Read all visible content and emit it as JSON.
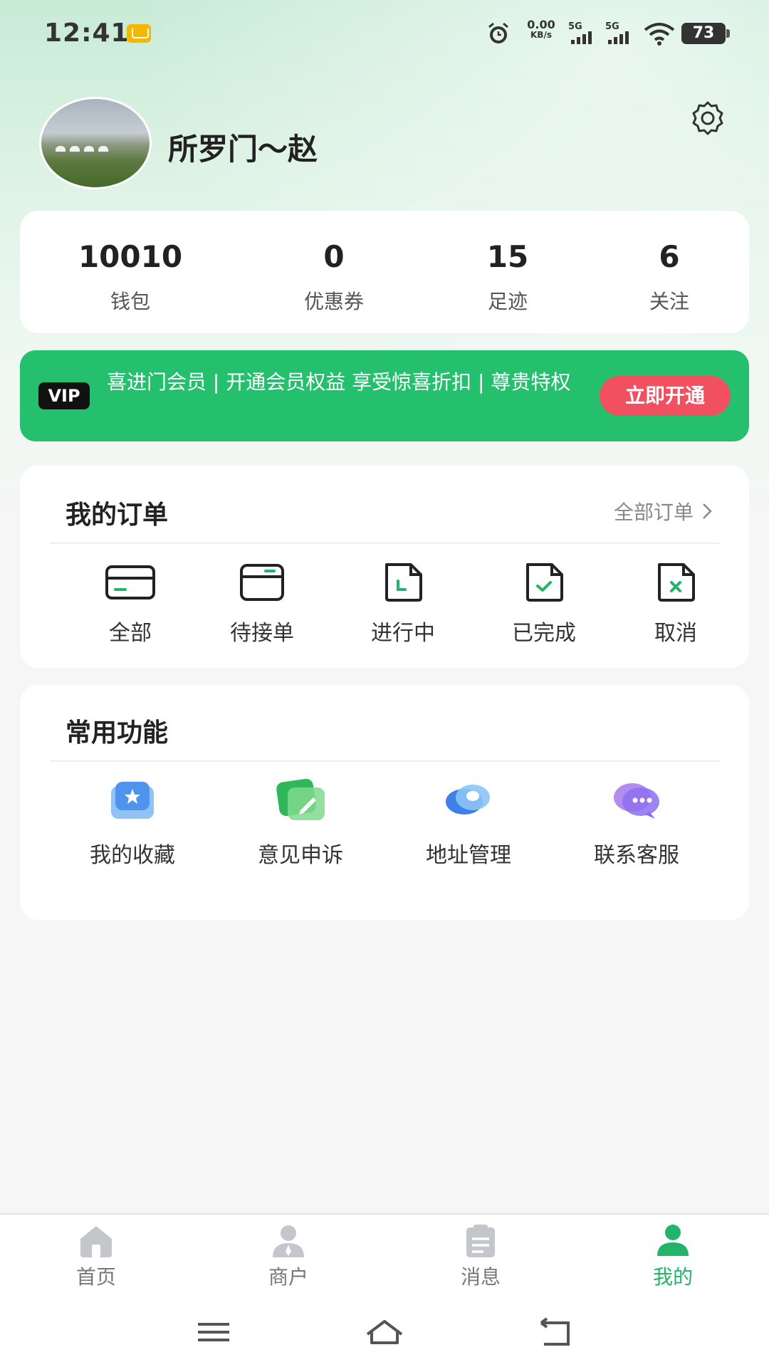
{
  "status_bar": {
    "time": "12:41",
    "net_speed_value": "0.00",
    "net_speed_unit": "KB/s",
    "signal_1": "5G",
    "signal_2": "5G",
    "battery": "73"
  },
  "profile": {
    "username": "所罗门～赵"
  },
  "stats": [
    {
      "value": "10010",
      "label": "钱包"
    },
    {
      "value": "0",
      "label": "优惠券"
    },
    {
      "value": "15",
      "label": "足迹"
    },
    {
      "value": "6",
      "label": "关注"
    }
  ],
  "vip": {
    "badge": "VIP",
    "text": "喜进门会员 | 开通会员权益 享受惊喜折扣 | 尊贵特权",
    "button": "立即开通"
  },
  "orders": {
    "title": "我的订单",
    "all_link": "全部订单",
    "items": [
      {
        "label": "全部",
        "icon": "card-icon"
      },
      {
        "label": "待接单",
        "icon": "inbox-icon"
      },
      {
        "label": "进行中",
        "icon": "doc-progress-icon"
      },
      {
        "label": "已完成",
        "icon": "doc-check-icon"
      },
      {
        "label": "取消",
        "icon": "doc-cancel-icon"
      }
    ]
  },
  "functions": {
    "title": "常用功能",
    "items": [
      {
        "label": "我的收藏",
        "icon": "favorites-icon"
      },
      {
        "label": "意见申诉",
        "icon": "feedback-icon"
      },
      {
        "label": "地址管理",
        "icon": "address-icon"
      },
      {
        "label": "联系客服",
        "icon": "customer-service-icon"
      }
    ]
  },
  "tabbar": [
    {
      "label": "首页",
      "icon": "home-icon",
      "active": false
    },
    {
      "label": "商户",
      "icon": "merchant-icon",
      "active": false
    },
    {
      "label": "消息",
      "icon": "message-icon",
      "active": false
    },
    {
      "label": "我的",
      "icon": "profile-icon",
      "active": true
    }
  ],
  "colors": {
    "accent": "#22b56a",
    "vip_bg": "#25c06d",
    "vip_button": "#f05060"
  }
}
